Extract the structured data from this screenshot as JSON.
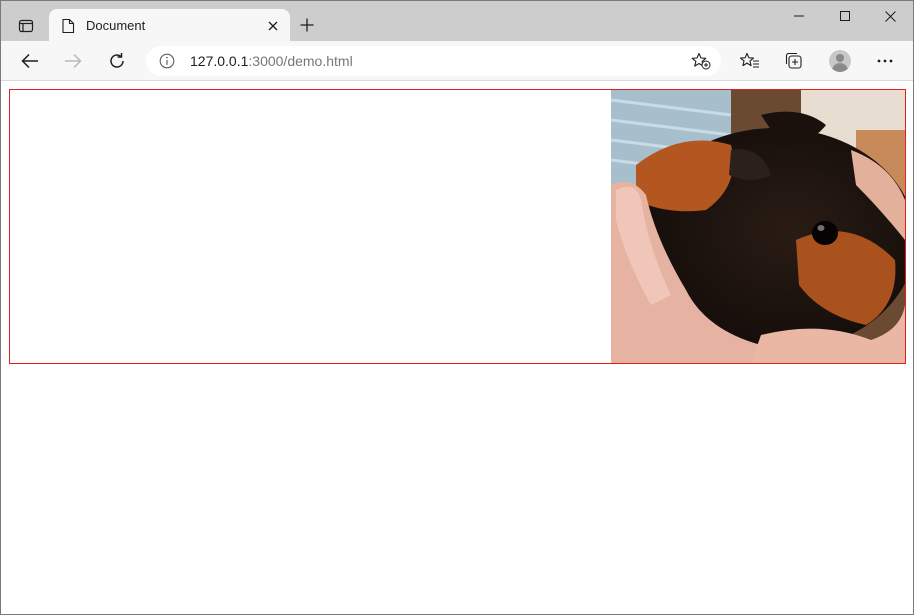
{
  "browser": {
    "tab": {
      "title": "Document",
      "icon": "document-icon"
    },
    "address": {
      "host": "127.0.0.1",
      "rest": ":3000/demo.html"
    }
  },
  "page": {
    "box_border_color": "#e0201f",
    "image": {
      "subject": "guinea pig held in hands",
      "colors": [
        "#1c130f",
        "#b05a22",
        "#e7b7a5",
        "#9fb8c9"
      ]
    }
  }
}
